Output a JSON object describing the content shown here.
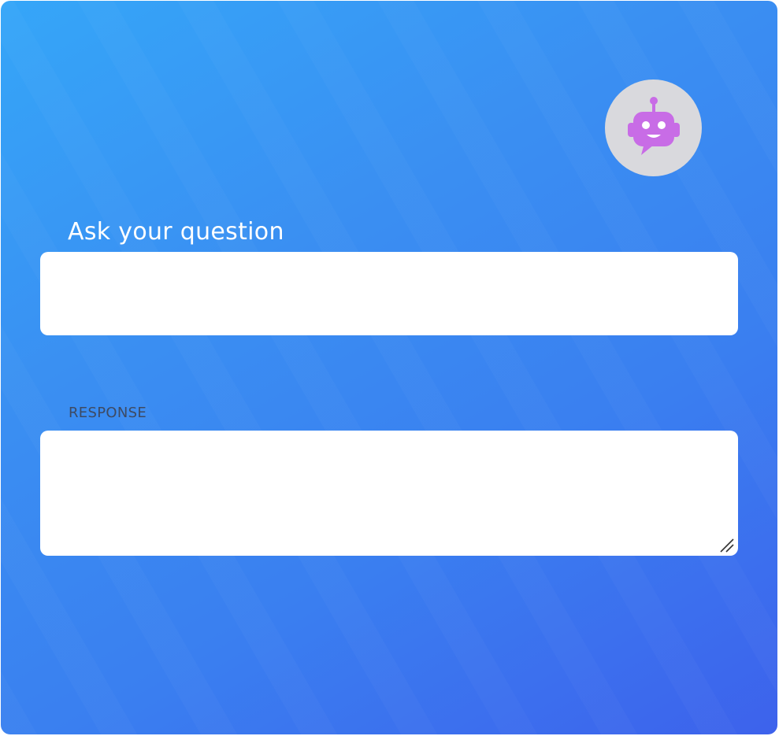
{
  "question": {
    "label": "Ask your question",
    "value": ""
  },
  "response": {
    "label": "RESPONSE",
    "value": ""
  },
  "avatar": {
    "icon": "robot-chat-icon",
    "icon_color": "#c86ce6",
    "background_color": "#d9d9dd"
  },
  "theme": {
    "gradient_start": "#35a6f8",
    "gradient_end": "#3d62ec"
  }
}
